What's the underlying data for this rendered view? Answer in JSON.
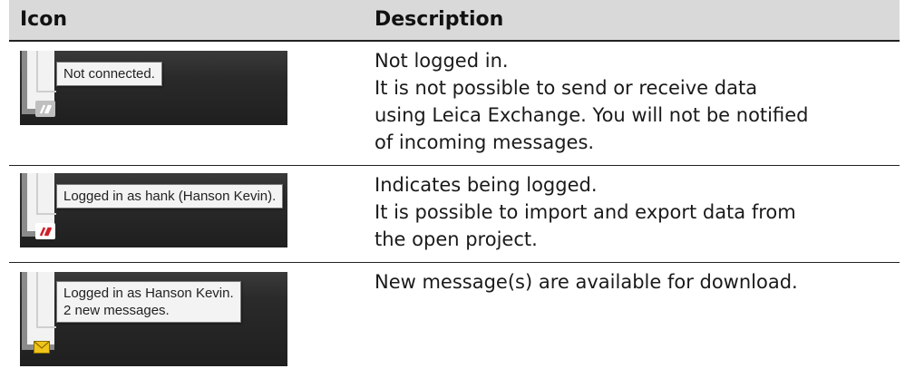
{
  "header": {
    "icon": "Icon",
    "description": "Description"
  },
  "rows": [
    {
      "tooltip": [
        "Not connected."
      ],
      "icon": "leica-exchange-disconnected-icon",
      "description": [
        "Not logged in.",
        "It is not possible to send or receive data",
        "using Leica Exchange. You will not be notified",
        "of incoming messages."
      ]
    },
    {
      "tooltip": [
        "Logged in as hank (Hanson Kevin)."
      ],
      "icon": "leica-exchange-connected-icon",
      "description": [
        "Indicates being logged.",
        "It is possible to import and export data from",
        "the open project."
      ]
    },
    {
      "tooltip": [
        "Logged in as Hanson Kevin.",
        "2 new messages."
      ],
      "icon": "envelope-icon",
      "description": [
        "New message(s) are available for download."
      ]
    }
  ],
  "colors": {
    "header_bg": "#d9d9d9",
    "taskbar": "#2a2a2a",
    "red_icon": "#d0202a",
    "envelope": "#f0c419"
  }
}
